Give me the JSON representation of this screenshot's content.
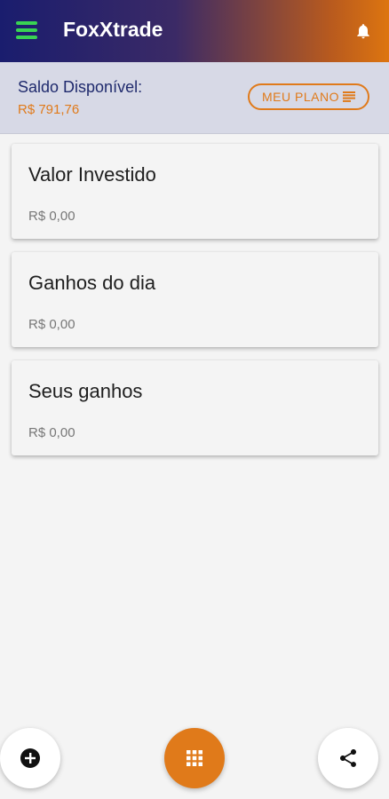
{
  "header": {
    "title": "FoxXtrade",
    "menu_icon": "menu-icon",
    "notification_icon": "bell-icon"
  },
  "balance": {
    "label": "Saldo Disponível:",
    "value": "R$ 791,76"
  },
  "plan_button": {
    "label": "MEU PLANO",
    "icon": "list-icon"
  },
  "cards": [
    {
      "title": "Valor Investido",
      "value": "R$ 0,00"
    },
    {
      "title": "Ganhos do dia",
      "value": "R$ 0,00"
    },
    {
      "title": "Seus ganhos",
      "value": "R$ 0,00"
    }
  ],
  "fabs": {
    "left_icon": "add-circle-icon",
    "center_icon": "apps-grid-icon",
    "right_icon": "share-icon"
  },
  "colors": {
    "accent": "#e07a1a",
    "header_start": "#1a1d6e",
    "header_end": "#dd7510",
    "menu_icon": "#39d353"
  }
}
